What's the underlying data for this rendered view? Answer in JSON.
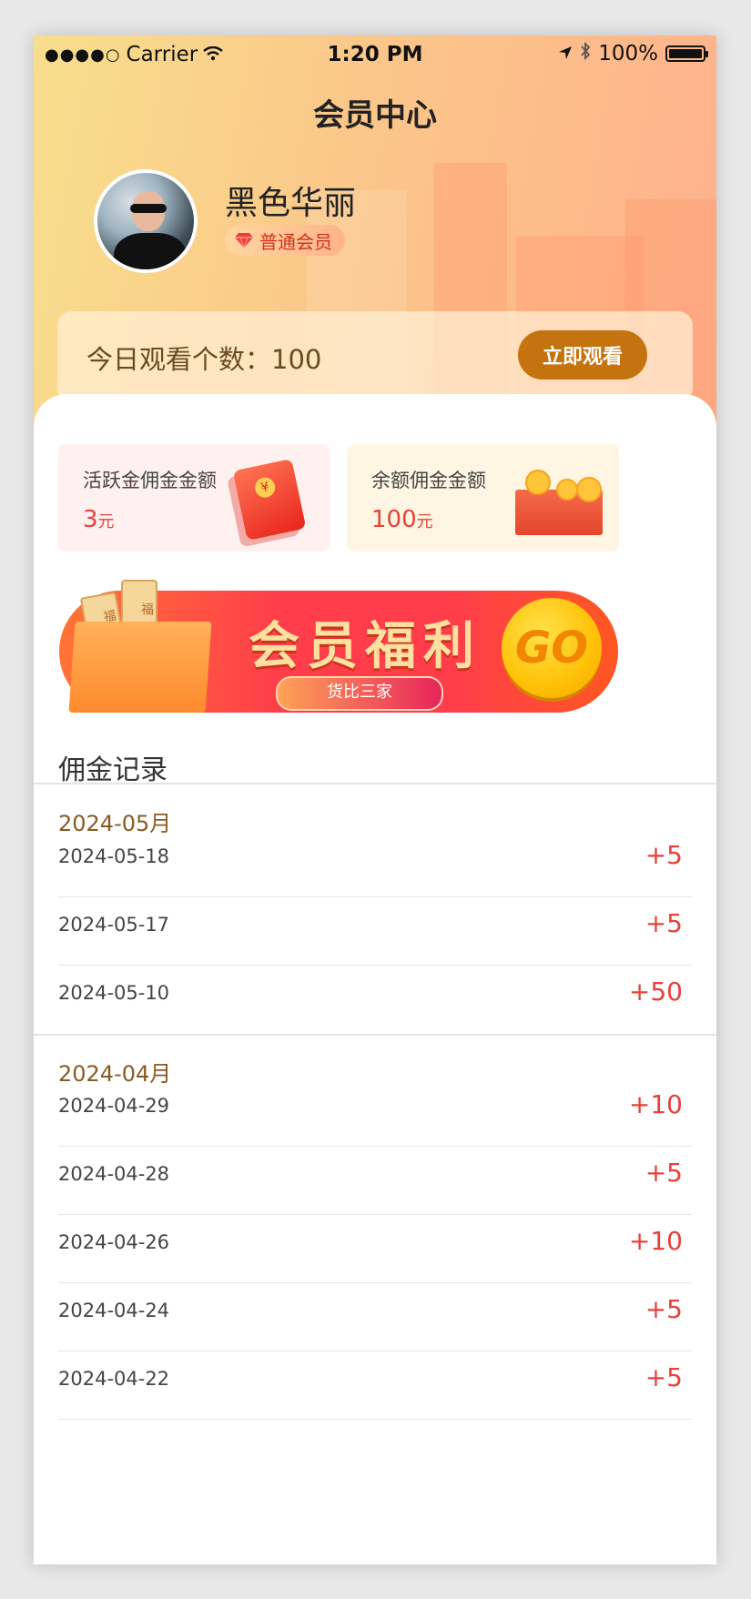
{
  "status_bar": {
    "signal": "●●●●○",
    "carrier": "Carrier",
    "time": "1:20 PM",
    "battery": "100%"
  },
  "header": {
    "title": "会员中心"
  },
  "profile": {
    "name": "黑色华丽",
    "level": "普通会员",
    "watch_label": "今日观看个数：100",
    "watch_button": "立即观看"
  },
  "earnings": [
    {
      "label": "活跃金佣金金额",
      "amount": "3",
      "unit": "元"
    },
    {
      "label": "余额佣金金额",
      "amount": "100",
      "unit": "元"
    }
  ],
  "banner": {
    "title": "会员福利",
    "subtitle": "货比三家",
    "go": "GO",
    "ticket1": "福利",
    "ticket2": "福"
  },
  "records": {
    "title": "佣金记录",
    "groups": [
      {
        "month": "2024-05月",
        "items": [
          {
            "date": "2024-05-18",
            "value": "+5"
          },
          {
            "date": "2024-05-17",
            "value": "+5"
          },
          {
            "date": "2024-05-10",
            "value": "+50"
          }
        ]
      },
      {
        "month": "2024-04月",
        "items": [
          {
            "date": "2024-04-29",
            "value": "+10"
          },
          {
            "date": "2024-04-28",
            "value": "+5"
          },
          {
            "date": "2024-04-26",
            "value": "+10"
          },
          {
            "date": "2024-04-24",
            "value": "+5"
          },
          {
            "date": "2024-04-22",
            "value": "+5"
          }
        ]
      }
    ]
  },
  "colors": {
    "accent_red": "#e8413b",
    "watch_button": "#c4730e",
    "month_brown": "#8a5a25"
  }
}
